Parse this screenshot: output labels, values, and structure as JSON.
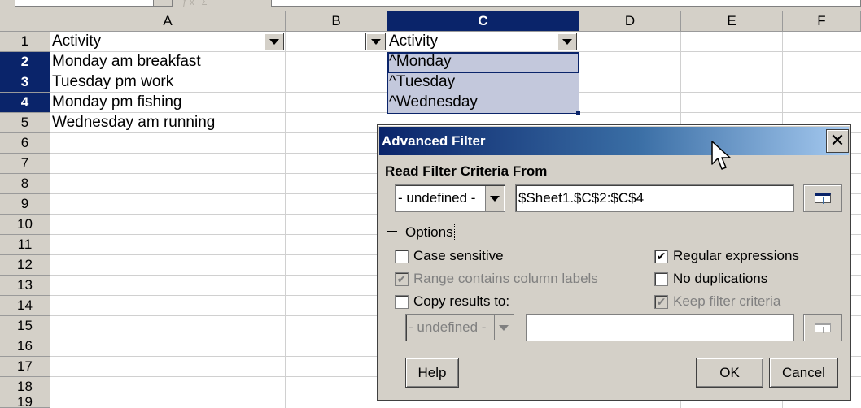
{
  "window": {
    "title": "Advanced Filter"
  },
  "sheet": {
    "columns": [
      "A",
      "B",
      "C",
      "D",
      "E",
      "F"
    ],
    "selected_column": "C",
    "rows": [
      "1",
      "2",
      "3",
      "4",
      "5",
      "6",
      "7",
      "8",
      "9",
      "10",
      "11",
      "12",
      "13",
      "14",
      "15",
      "16",
      "17",
      "18",
      "19"
    ],
    "selected_rows": [
      "2",
      "3",
      "4"
    ],
    "cells": {
      "A1": "Activity",
      "C1": "Activity",
      "A2": "Monday am breakfast",
      "A3": "Tuesday pm work",
      "A4": "Monday pm fishing",
      "A5": "Wednesday am running",
      "C2": "^Monday",
      "C3": "^Tuesday",
      "C4": "^Wednesday"
    }
  },
  "dialog": {
    "title": "Advanced Filter",
    "close_label": "✕",
    "criteria_section": "Read Filter Criteria From",
    "criteria_combo_value": "- undefined -",
    "criteria_range_value": "$Sheet1.$C$2:$C$4",
    "options_label": "Options",
    "options": {
      "case_sensitive": {
        "label": "Case sensitive",
        "checked": false,
        "enabled": true
      },
      "range_has_labels": {
        "label": "Range contains column labels",
        "checked": true,
        "enabled": false
      },
      "copy_results": {
        "label": "Copy results to:",
        "checked": false,
        "enabled": true
      },
      "regular_expressions": {
        "label": "Regular expressions",
        "checked": true,
        "enabled": true
      },
      "no_duplications": {
        "label": "No duplications",
        "checked": false,
        "enabled": true
      },
      "keep_filter_criteria": {
        "label": "Keep filter criteria",
        "checked": true,
        "enabled": false
      }
    },
    "copy_combo_value": "- undefined -",
    "copy_range_value": "",
    "buttons": {
      "help": "Help",
      "ok": "OK",
      "cancel": "Cancel"
    }
  }
}
